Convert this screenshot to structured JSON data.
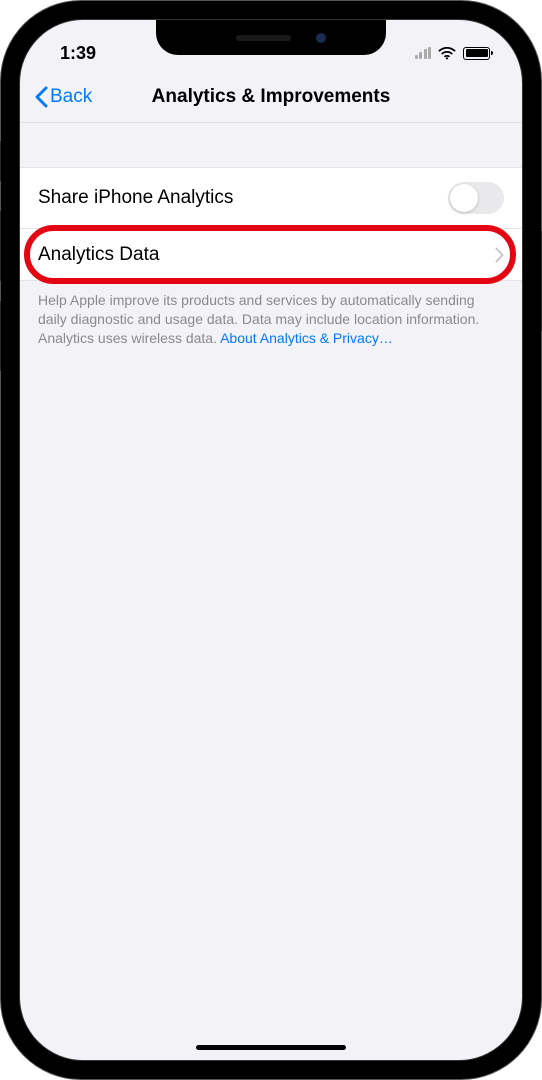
{
  "statusBar": {
    "time": "1:39"
  },
  "nav": {
    "backLabel": "Back",
    "title": "Analytics & Improvements"
  },
  "rows": {
    "shareAnalytics": {
      "label": "Share iPhone Analytics"
    },
    "analyticsData": {
      "label": "Analytics Data"
    }
  },
  "footer": {
    "text": "Help Apple improve its products and services by automatically sending daily diagnostic and usage data. Data may include location information. Analytics uses wireless data. ",
    "linkText": "About Analytics & Privacy…"
  }
}
